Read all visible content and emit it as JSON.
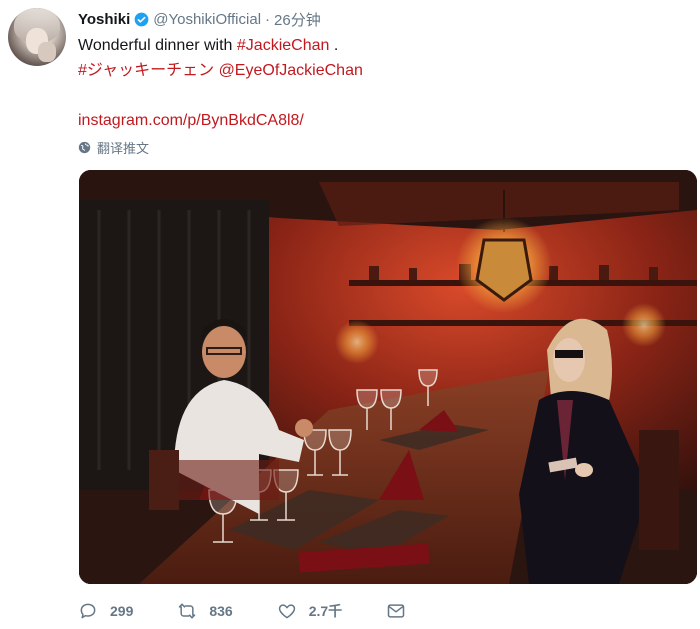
{
  "tweet": {
    "author_name": "Yoshiki",
    "handle": "@YoshikiOfficial",
    "separator": "·",
    "time": "26分钟",
    "text_line1_prefix": "Wonderful dinner with ",
    "text_line1_hashtag": "#JackieChan",
    "text_line1_suffix": " .",
    "text_line2_hashtag": "#ジャッキーチェン",
    "text_line2_mention": "@EyeOfJackieChan",
    "link": "instagram.com/p/BynBkdCA8l8/",
    "translate_label": "翻译推文"
  },
  "actions": {
    "reply_count": "299",
    "retweet_count": "836",
    "like_count": "2.7千"
  },
  "colors": {
    "link": "#c2191f",
    "meta": "#657786",
    "verified": "#1da1f2"
  },
  "icons": [
    "verified-badge-icon",
    "globe-icon",
    "reply-icon",
    "retweet-icon",
    "like-icon",
    "direct-message-icon"
  ]
}
